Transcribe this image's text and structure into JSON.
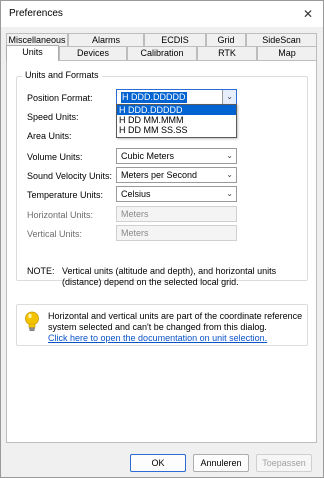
{
  "window": {
    "title": "Preferences",
    "close_glyph": "✕"
  },
  "tabs_back": [
    "Miscellaneous",
    "Alarms",
    "ECDIS",
    "Grid",
    "SideScan"
  ],
  "tabs_front": [
    "Units",
    "Devices",
    "Calibration",
    "RTK",
    "Map"
  ],
  "active_tab": "Units",
  "group": {
    "title": "Units and Formats",
    "position_format": {
      "label": "Position Format:",
      "value": "H DDD.DDDDD"
    },
    "speed_units": {
      "label": "Speed Units:"
    },
    "area_units": {
      "label": "Area Units:"
    },
    "volume_units": {
      "label": "Volume Units:",
      "value": "Cubic Meters"
    },
    "sound_velocity_units": {
      "label": "Sound Velocity Units:",
      "value": "Meters per Second"
    },
    "temperature_units": {
      "label": "Temperature Units:",
      "value": "Celsius"
    },
    "horizontal_units": {
      "label": "Horizontal Units:",
      "value": "Meters"
    },
    "vertical_units": {
      "label": "Vertical Units:",
      "value": "Meters"
    }
  },
  "dropdown_options": [
    "H DDD.DDDDD",
    "H DD MM.MMM",
    "H DD MM SS.SS"
  ],
  "note": {
    "label": "NOTE:",
    "text": "Vertical units (altitude and depth), and horizontal units (distance) depend on the selected local grid."
  },
  "info": {
    "text": "Horizontal and vertical units are part of the coordinate reference system selected and can't be changed from this dialog.",
    "link": "Click here to open the documentation on unit selection."
  },
  "buttons": {
    "ok": "OK",
    "cancel": "Annuleren",
    "apply": "Toepassen"
  },
  "colors": {
    "accent": "#0063d1",
    "link": "#0a52c7",
    "bulb": "#f5c400"
  }
}
